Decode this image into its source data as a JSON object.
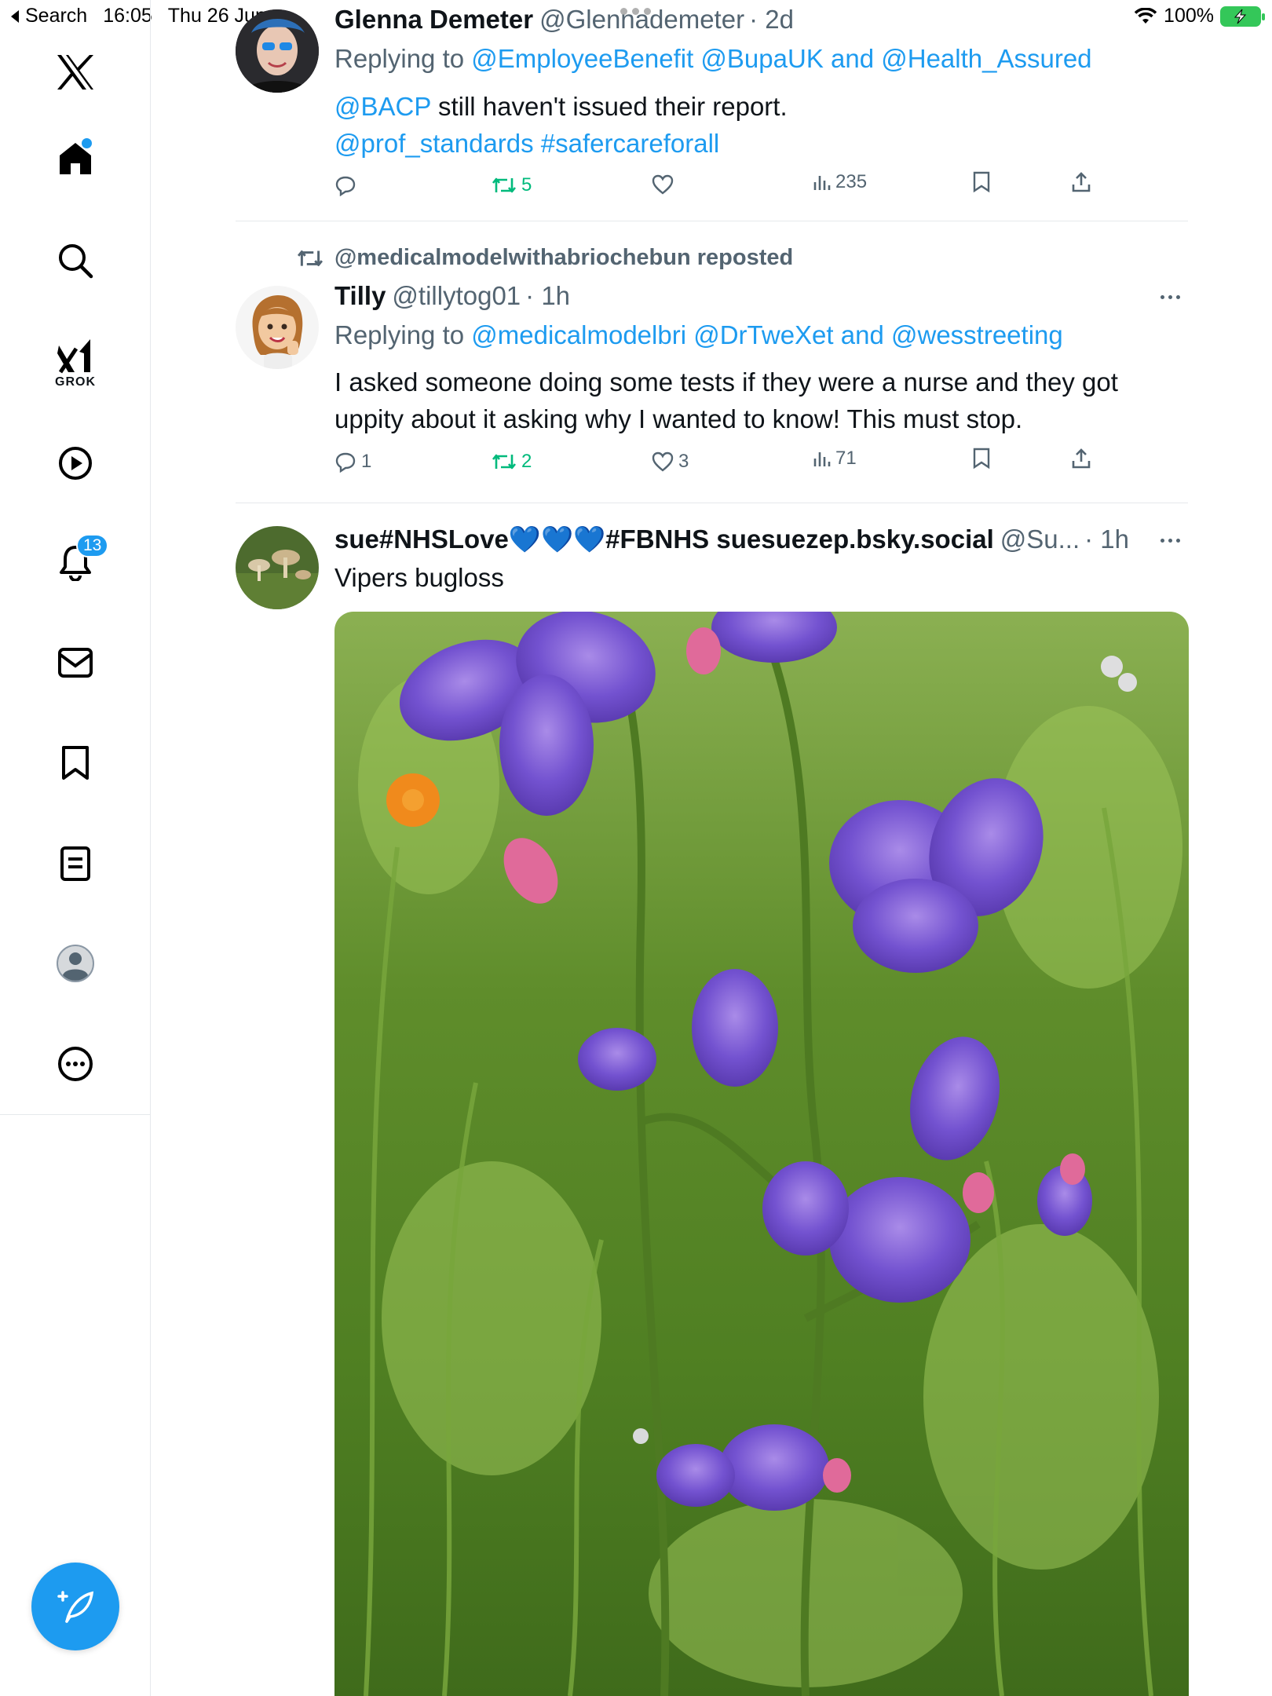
{
  "status_bar": {
    "back_label": "Search",
    "time": "16:05",
    "date": "Thu 26 Jun",
    "battery": "100%"
  },
  "sidebar": {
    "grok_label": "GROK",
    "notifications_count": "13"
  },
  "tweets": [
    {
      "name": "Glenna Demeter",
      "handle": "@Glennademeter",
      "time": "· 2d",
      "replying_prefix": "Replying to ",
      "replying_1": "@EmployeeBenefit @BupaUK",
      "replying_and": " and ",
      "replying_2": "@Health_Assured",
      "line1_mention": "@BACP",
      "line1_text": " still haven't issued their report.",
      "line2_text": "@prof_standards #safercareforall",
      "replies": "",
      "reposts": "5",
      "likes": "",
      "views": "235"
    },
    {
      "repost_label": "@medicalmodelwithabriochebun reposted",
      "name": "Tilly",
      "handle": "@tillytog01",
      "time": "· 1h",
      "replying_prefix": "Replying to ",
      "replying_1": "@medicalmodelbri @DrTweXet",
      "replying_and": " and ",
      "replying_2": "@wesstreeting",
      "body_line1": "I asked someone doing some tests if they were a nurse and they got",
      "body_line2": "uppity about it asking why I wanted to know! This must stop.",
      "replies": "1",
      "reposts": "2",
      "likes": "3",
      "views": "71"
    },
    {
      "name": "sue#NHSLove💙💙💙#FBNHS suesuezep.bsky.social",
      "handle": "@Su...",
      "time": "· 1h",
      "body": "Vipers bugloss"
    }
  ],
  "colors": {
    "accent": "#1d9bf0",
    "repost_green": "#00ba7c",
    "secondary_text": "#536471"
  }
}
